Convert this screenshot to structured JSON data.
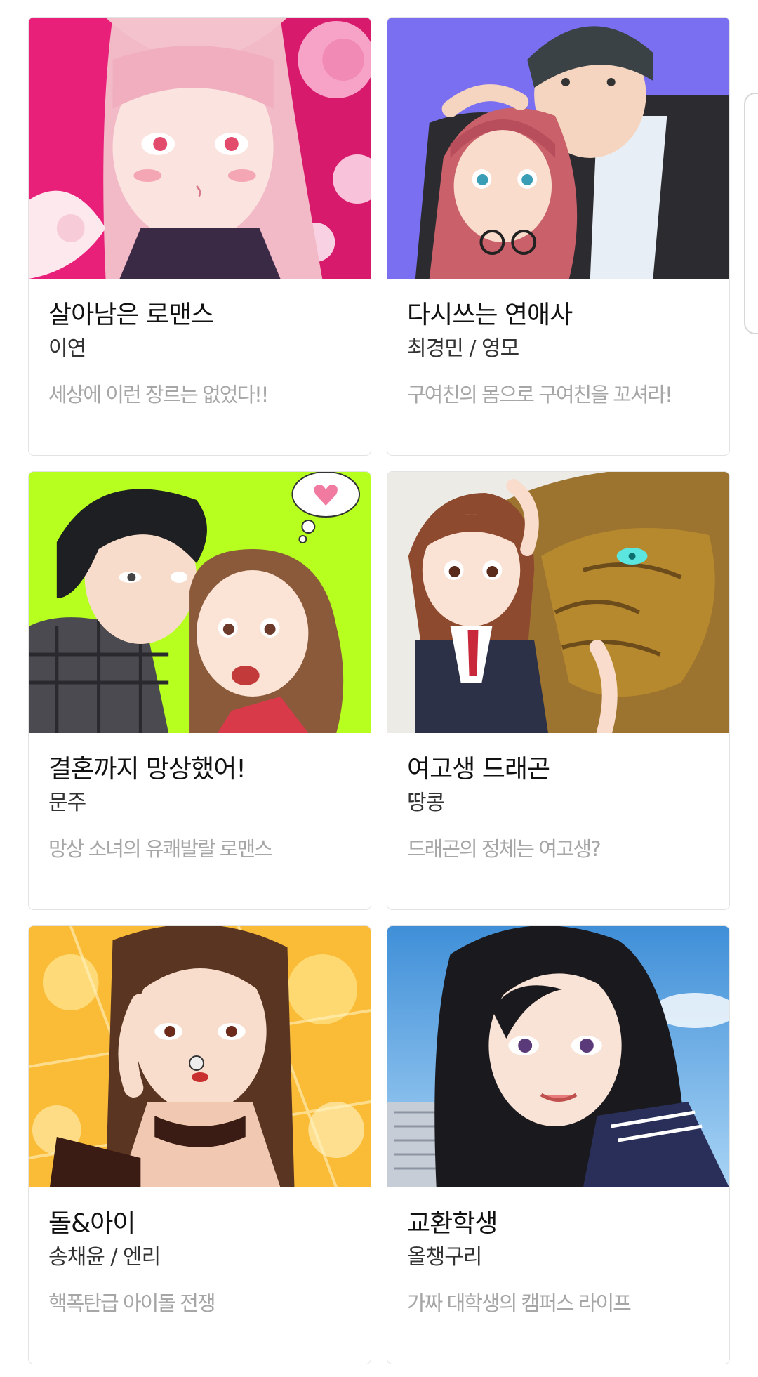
{
  "cards": [
    {
      "title": "살아남은 로맨스",
      "author": "이연",
      "description": "세상에 이런 장르는 없었다!!",
      "thumbnail_icon": "pink-haired-girl-cover",
      "accent": "#e8207a"
    },
    {
      "title": "다시쓰는 연애사",
      "author": "최경민 / 영모",
      "description": "구여친의 몸으로 구여친을 꼬셔라!",
      "thumbnail_icon": "couple-with-glasses-cover",
      "accent": "#7a6ff0"
    },
    {
      "title": "결혼까지 망상했어!",
      "author": "문주",
      "description": "망상 소녀의 유쾌발랄 로맨스",
      "thumbnail_icon": "couple-heart-bubble-cover",
      "accent": "#b6ff1e"
    },
    {
      "title": "여고생 드래곤",
      "author": "땅콩",
      "description": "드래곤의 정체는 여고생?",
      "thumbnail_icon": "schoolgirl-and-dragon-cover",
      "accent": "#b7892e"
    },
    {
      "title": "돌&아이",
      "author": "송채윤 / 엔리",
      "description": "핵폭탄급 아이돌 전쟁",
      "thumbnail_icon": "idol-with-microphone-cover",
      "accent": "#f5a623"
    },
    {
      "title": "교환학생",
      "author": "올챙구리",
      "description": "가짜 대학생의 캠퍼스 라이프",
      "thumbnail_icon": "black-haired-student-cover",
      "accent": "#3f8fd8"
    }
  ]
}
